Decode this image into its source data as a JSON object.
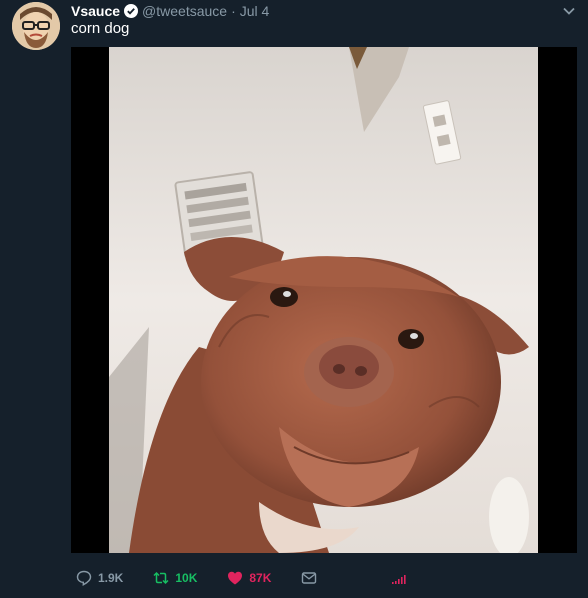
{
  "tweet": {
    "author": {
      "name": "Vsauce",
      "handle": "@tweetsauce",
      "verified": true,
      "avatar_icon": "bearded-man-glasses-avatar"
    },
    "separator": "·",
    "timestamp": "Jul 4",
    "text": "corn dog",
    "media": {
      "alt": "photo of a brown dog looking down at the camera"
    },
    "actions": {
      "replies": "1.9K",
      "retweets": "10K",
      "likes": "87K",
      "liked": true
    }
  },
  "colors": {
    "background": "#15202b",
    "secondary_text": "#8899a6",
    "verified_blue": "#1da1f2",
    "retweet_green": "#17bf63",
    "like_red": "#e0245e",
    "analytics_red": "#e0245e"
  },
  "icons": {
    "reply": "speech-bubble-icon",
    "retweet": "retweet-arrows-icon",
    "like": "heart-icon",
    "dm": "envelope-icon",
    "analytics": "bar-chart-icon",
    "menu": "chevron-down-icon"
  }
}
